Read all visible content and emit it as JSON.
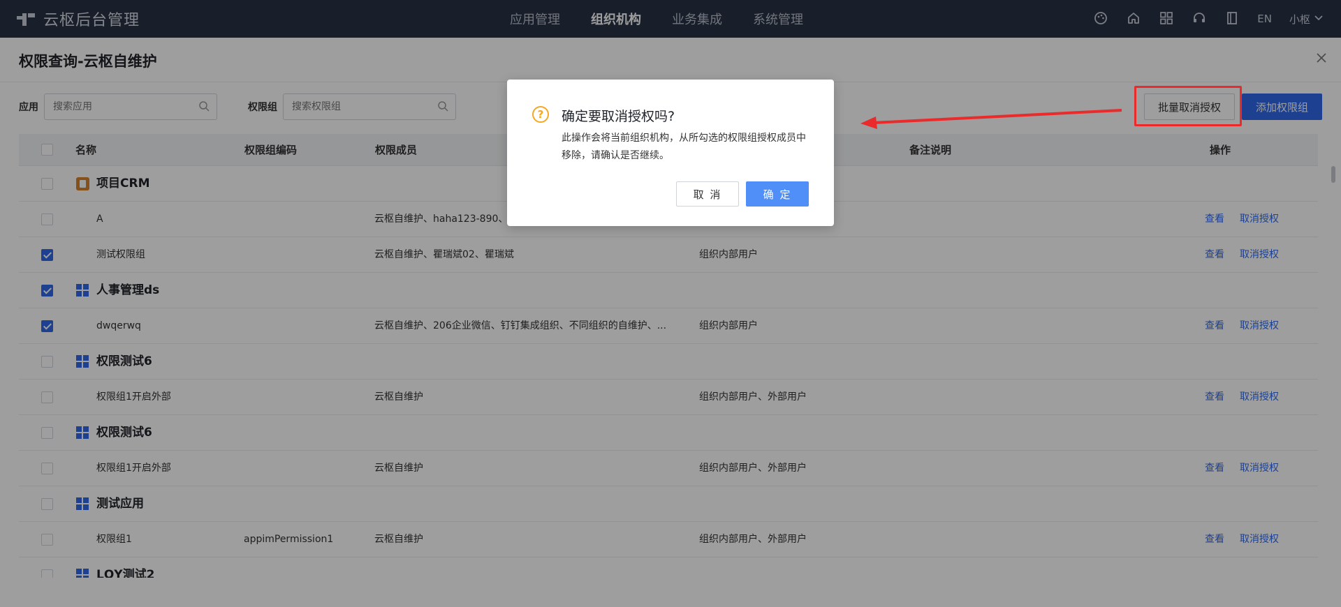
{
  "topbar": {
    "brand": "云枢后台管理",
    "nav": [
      "应用管理",
      "组织机构",
      "业务集成",
      "系统管理"
    ],
    "active_nav": 1,
    "lang": "EN",
    "user": "小枢",
    "icons": [
      "palette-icon",
      "home-icon",
      "apps-grid-icon",
      "headset-icon",
      "book-icon"
    ]
  },
  "page": {
    "title": "权限查询-云枢自维护"
  },
  "filters": {
    "app_label": "应用",
    "app_placeholder": "搜索应用",
    "group_label": "权限组",
    "group_placeholder": "搜索权限组"
  },
  "toolbar": {
    "batch_revoke": "批量取消授权",
    "add_group": "添加权限组"
  },
  "table": {
    "headers": {
      "name": "名称",
      "code": "权限组编码",
      "members": "权限成员",
      "scope": "",
      "remark": "备注说明",
      "actions": "操作"
    },
    "view_label": "查看",
    "revoke_label": "取消授权",
    "rows": [
      {
        "type": "group",
        "name": "项目CRM",
        "icon": "crm",
        "checked": false
      },
      {
        "type": "item",
        "name": "A",
        "code": "",
        "members": "云枢自维护、haha123-890、",
        "scope": "",
        "checked": false
      },
      {
        "type": "item",
        "name": "测试权限组",
        "code": "",
        "members": "云枢自维护、瞿瑞斌02、瞿瑞斌",
        "scope": "组织内部用户",
        "checked": true
      },
      {
        "type": "group",
        "name": "人事管理ds",
        "icon": "grid",
        "checked": true
      },
      {
        "type": "item",
        "name": "dwqerwq",
        "code": "",
        "members": "云枢自维护、206企业微信、钉钉集成组织、不同组织的自维护、...",
        "scope": "组织内部用户",
        "checked": true
      },
      {
        "type": "group",
        "name": "权限测试6",
        "icon": "grid",
        "checked": false
      },
      {
        "type": "item",
        "name": "权限组1开启外部",
        "code": "",
        "members": "云枢自维护",
        "scope": "组织内部用户、外部用户",
        "checked": false
      },
      {
        "type": "group",
        "name": "权限测试6",
        "icon": "grid",
        "checked": false
      },
      {
        "type": "item",
        "name": "权限组1开启外部",
        "code": "",
        "members": "云枢自维护",
        "scope": "组织内部用户、外部用户",
        "checked": false
      },
      {
        "type": "group",
        "name": "测试应用",
        "icon": "grid",
        "checked": false
      },
      {
        "type": "item",
        "name": "权限组1",
        "code": "appimPermission1",
        "members": "云枢自维护",
        "scope": "组织内部用户、外部用户",
        "checked": false
      },
      {
        "type": "group",
        "name": "LQY测试2",
        "icon": "grid",
        "checked": false
      }
    ]
  },
  "dialog": {
    "title": "确定要取消授权吗?",
    "body": "此操作会将当前组织机构，从所勾选的权限组授权成员中移除，请确认是否继续。",
    "cancel": "取 消",
    "ok": "确 定"
  },
  "colors": {
    "primary": "#2f69e8",
    "topbar": "#273246",
    "warning": "#f5a623",
    "highlight": "#ea2b2b"
  }
}
